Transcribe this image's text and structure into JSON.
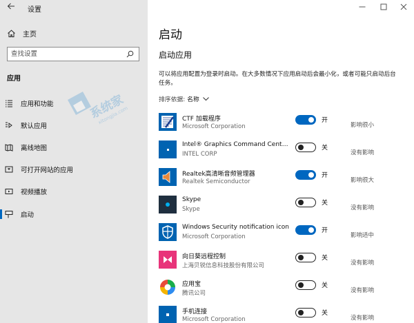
{
  "window": {
    "title": "设置"
  },
  "sidebar": {
    "home_label": "主页",
    "search_placeholder": "查找设置",
    "section_label": "应用",
    "items": [
      {
        "label": "应用和功能",
        "icon": "apps-list-icon"
      },
      {
        "label": "默认应用",
        "icon": "default-apps-icon"
      },
      {
        "label": "离线地图",
        "icon": "offline-maps-icon"
      },
      {
        "label": "可打开网站的应用",
        "icon": "apps-for-websites-icon"
      },
      {
        "label": "视频播放",
        "icon": "video-playback-icon"
      },
      {
        "label": "启动",
        "icon": "startup-icon",
        "active": true
      }
    ]
  },
  "main": {
    "title": "启动",
    "subtitle": "启动应用",
    "description": "可以将应用配置为登录时启动。在大多数情况下应用启动后会最小化，或者可能只启动后台任务。",
    "sort_label": "排序依据:",
    "sort_value": "名称",
    "apps": [
      {
        "name": "CTF 加载程序",
        "publisher": "Microsoft Corporation",
        "on": true,
        "state": "开",
        "impact": "影响很小"
      },
      {
        "name": "Intel® Graphics Command Center S...",
        "publisher": "INTEL CORP",
        "on": false,
        "state": "关",
        "impact": "没有影响"
      },
      {
        "name": "Realtek高清晰音频管理器",
        "publisher": "Realtek Semiconductor",
        "on": true,
        "state": "开",
        "impact": "影响很大"
      },
      {
        "name": "Skype",
        "publisher": "Skype",
        "on": false,
        "state": "关",
        "impact": "没有影响"
      },
      {
        "name": "Windows Security notification icon",
        "publisher": "Microsoft Corporation",
        "on": true,
        "state": "开",
        "impact": "影响适中"
      },
      {
        "name": "向日葵远程控制",
        "publisher": "上海贝锐信息科技股份有限公司",
        "on": false,
        "state": "关",
        "impact": "没有影响"
      },
      {
        "name": "应用宝",
        "publisher": "腾讯公司",
        "on": false,
        "state": "关",
        "impact": "没有影响"
      },
      {
        "name": "手机连接",
        "publisher": "Microsoft Corporation",
        "on": false,
        "state": "关",
        "impact": "没有影响"
      }
    ]
  },
  "colors": {
    "accent": "#0067c0",
    "sidebar_bg": "#e6e6e6"
  }
}
